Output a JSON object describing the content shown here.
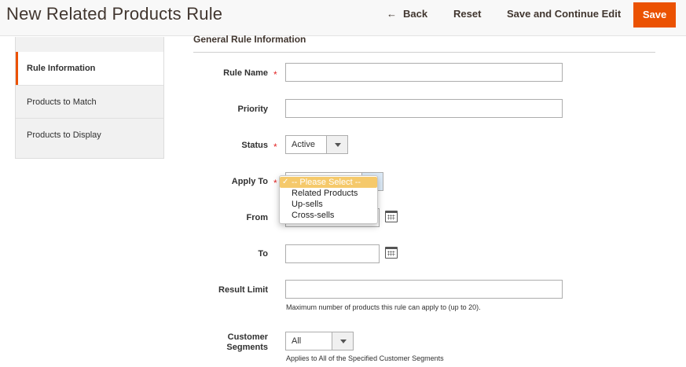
{
  "header": {
    "title": "New Related Products Rule",
    "back_label": "Back",
    "reset_label": "Reset",
    "save_continue_label": "Save and Continue Edit",
    "save_label": "Save"
  },
  "sidebar": {
    "items": [
      {
        "label": "Rule Information",
        "active": true
      },
      {
        "label": "Products to Match",
        "active": false
      },
      {
        "label": "Products to Display",
        "active": false
      }
    ]
  },
  "form": {
    "section_title": "General Rule Information",
    "rule_name": {
      "label": "Rule Name",
      "value": ""
    },
    "priority": {
      "label": "Priority",
      "value": ""
    },
    "status": {
      "label": "Status",
      "value": "Active"
    },
    "apply_to": {
      "label": "Apply To",
      "options": [
        "-- Please Select --",
        "Related Products",
        "Up-sells",
        "Cross-sells"
      ],
      "selected": "-- Please Select --",
      "check": "✓"
    },
    "from": {
      "label": "From",
      "value": ""
    },
    "to": {
      "label": "To",
      "value": ""
    },
    "result_limit": {
      "label": "Result Limit",
      "value": "",
      "note": "Maximum number of products this rule can apply to (up to 20)."
    },
    "customer_segments": {
      "label_line1": "Customer",
      "label_line2": "Segments",
      "value": "All",
      "note": "Applies to All of the Specified Customer Segments"
    },
    "required_mark": "*"
  },
  "colors": {
    "accent": "#eb5202",
    "required": "#e22626",
    "dropdown_highlight": "#f5c96b"
  }
}
